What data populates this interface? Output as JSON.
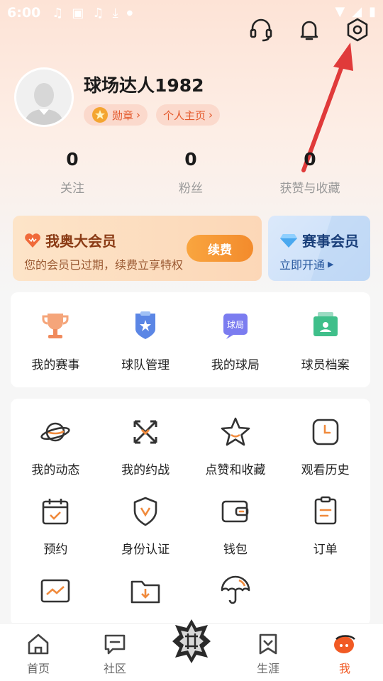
{
  "status_bar": {
    "time": "6:00"
  },
  "profile": {
    "username": "球场达人1982",
    "badge_chip": "勋章",
    "homepage_chip": "个人主页"
  },
  "stats": [
    {
      "value": "0",
      "label": "关注"
    },
    {
      "value": "0",
      "label": "粉丝"
    },
    {
      "value": "0",
      "label": "获赞与收藏"
    }
  ],
  "vip": {
    "title": "我奥大会员",
    "subtitle": "您的会员已过期，续费立享特权",
    "button": "续费"
  },
  "event_vip": {
    "title": "赛事会员",
    "subtitle": "立即开通"
  },
  "quick_panel": [
    {
      "label": "我的赛事",
      "icon": "trophy-icon"
    },
    {
      "label": "球队管理",
      "icon": "team-shield-icon"
    },
    {
      "label": "我的球局",
      "icon": "game-icon"
    },
    {
      "label": "球员档案",
      "icon": "player-profile-icon"
    }
  ],
  "feature_panel": [
    {
      "label": "我的动态",
      "icon": "planet-icon"
    },
    {
      "label": "我的约战",
      "icon": "battle-icon"
    },
    {
      "label": "点赞和收藏",
      "icon": "star-icon"
    },
    {
      "label": "观看历史",
      "icon": "clock-icon"
    },
    {
      "label": "预约",
      "icon": "calendar-icon"
    },
    {
      "label": "身份认证",
      "icon": "verify-shield-icon"
    },
    {
      "label": "钱包",
      "icon": "wallet-icon"
    },
    {
      "label": "订单",
      "icon": "order-icon"
    },
    {
      "label": "",
      "icon": "trend-icon"
    },
    {
      "label": "",
      "icon": "download-folder-icon"
    },
    {
      "label": "",
      "icon": "umbrella-icon"
    }
  ],
  "quick_game_icon_text": "球局",
  "bottom_nav": [
    {
      "label": "首页",
      "icon": "home-icon"
    },
    {
      "label": "社区",
      "icon": "community-icon"
    },
    {
      "label": "",
      "icon": "center-logo-icon"
    },
    {
      "label": "生涯",
      "icon": "career-icon"
    },
    {
      "label": "我",
      "icon": "me-icon"
    }
  ],
  "colors": {
    "accent": "#f15a24",
    "orange": "#f38b2c",
    "vip_text": "#8a3a14",
    "event_text": "#1a3f7a",
    "arrow": "#e03a3a"
  }
}
